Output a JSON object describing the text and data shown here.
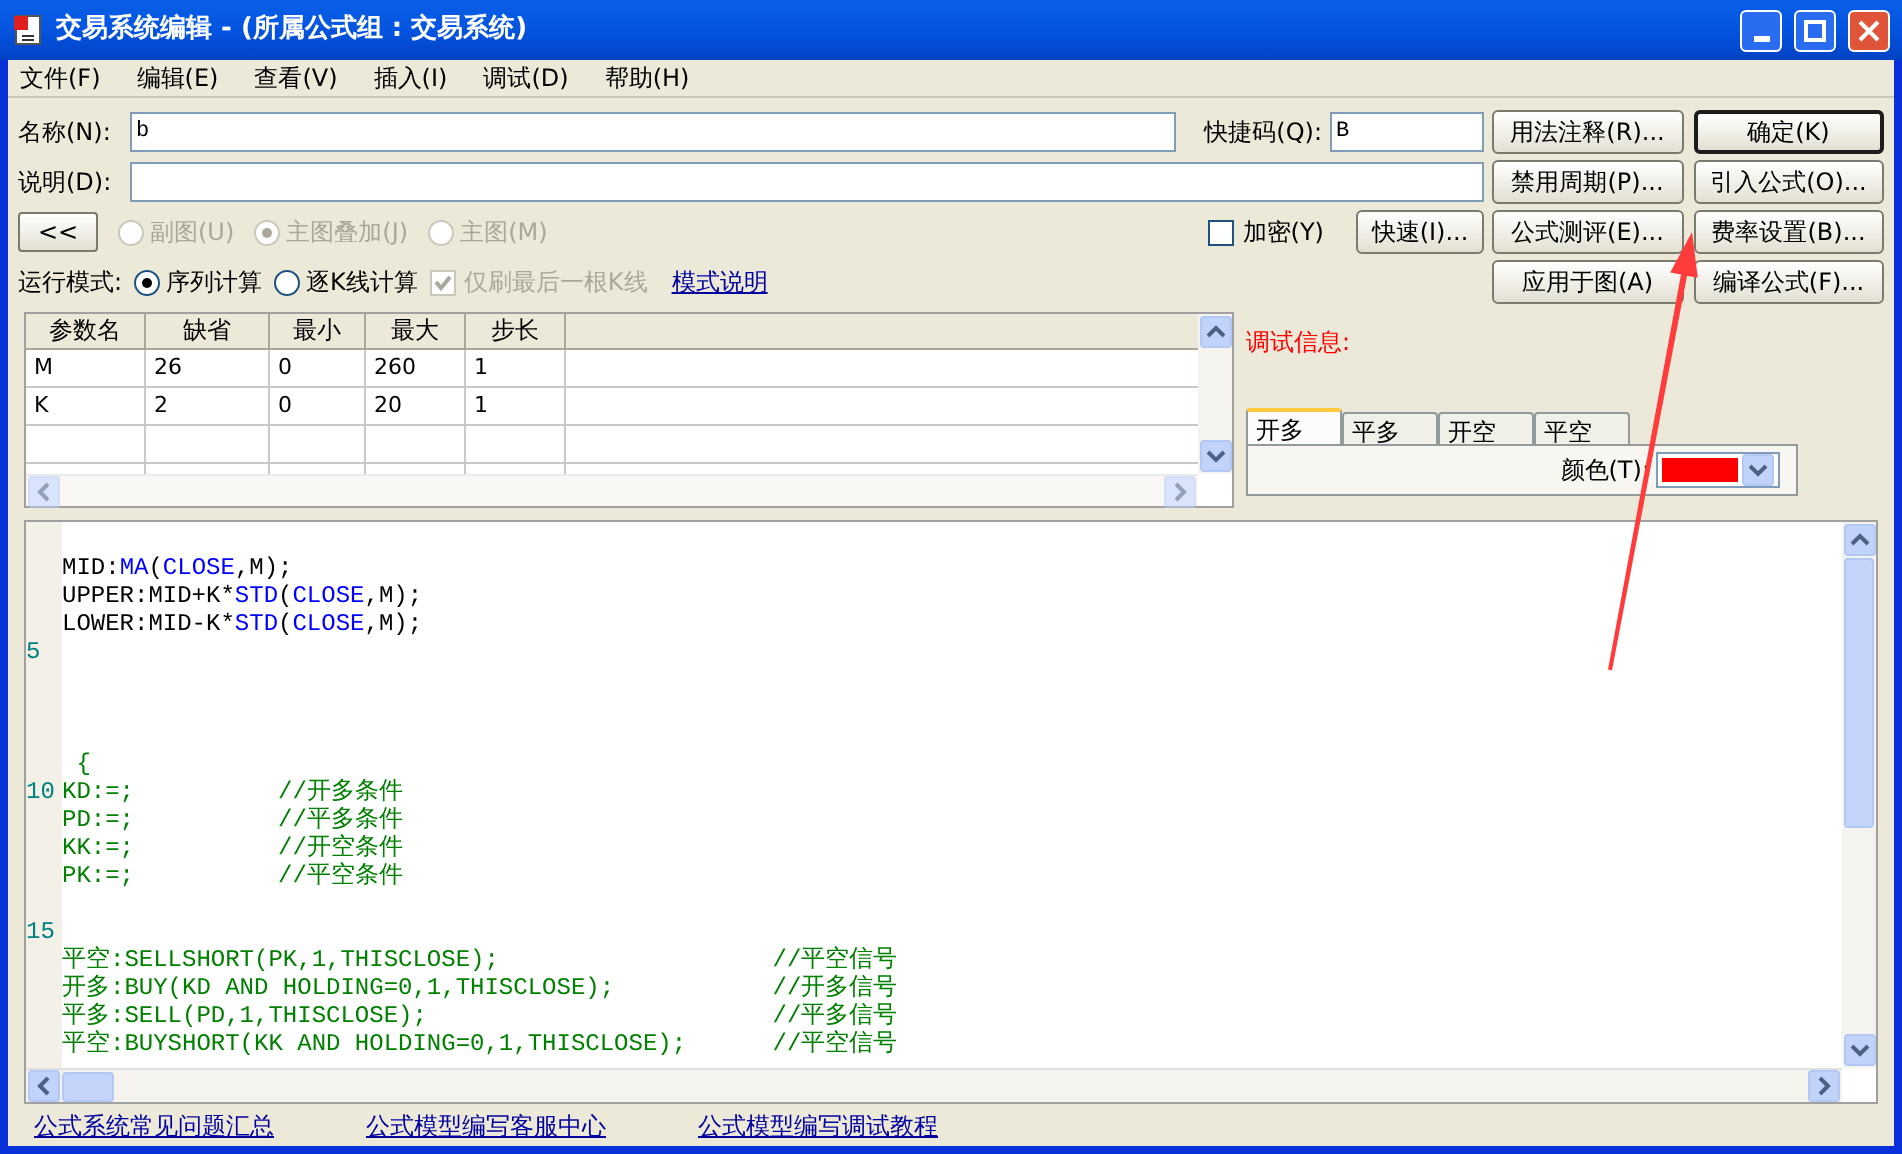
{
  "window": {
    "title": "交易系统编辑 - (所属公式组 : 交易系统)"
  },
  "menu": [
    "文件(F)",
    "编辑(E)",
    "查看(V)",
    "插入(I)",
    "调试(D)",
    "帮助(H)"
  ],
  "form": {
    "name_label": "名称(N):",
    "name_value": "b",
    "shortcut_label": "快捷码(Q):",
    "shortcut_value": "B",
    "desc_label": "说明(D):"
  },
  "collapse_button": "<<",
  "chart_modes": [
    {
      "label": "副图(U)",
      "selected": false,
      "disabled": true
    },
    {
      "label": "主图叠加(J)",
      "selected": true,
      "disabled": true
    },
    {
      "label": "主图(M)",
      "selected": false,
      "disabled": true
    }
  ],
  "encrypt": {
    "label": "加密(Y)",
    "checked": false
  },
  "quick_button": "快速(I)...",
  "run_mode": {
    "label": "运行模式:",
    "options": [
      {
        "label": "序列计算",
        "selected": true
      },
      {
        "label": "逐K线计算",
        "selected": false
      }
    ],
    "refresh_last": {
      "label": "仅刷最后一根K线",
      "checked": true,
      "disabled": true
    },
    "help_link": "模式说明"
  },
  "buttons": [
    {
      "label": "用法注释(R)...",
      "default": false
    },
    {
      "label": "确定(K)",
      "default": true
    },
    {
      "label": "禁用周期(P)...",
      "default": false
    },
    {
      "label": "引入公式(O)...",
      "default": false
    },
    {
      "label": "公式测评(E)...",
      "default": false
    },
    {
      "label": "费率设置(B)...",
      "default": false
    },
    {
      "label": "应用于图(A)",
      "default": false
    },
    {
      "label": "编译公式(F)...",
      "default": false
    }
  ],
  "params_table": {
    "columns": [
      "参数名",
      "缺省",
      "最小",
      "最大",
      "步长"
    ],
    "rows": [
      [
        "M",
        "26",
        "0",
        "260",
        "1"
      ],
      [
        "K",
        "2",
        "0",
        "20",
        "1"
      ]
    ]
  },
  "debug": {
    "label": "调试信息:"
  },
  "signal_tabs": [
    {
      "label": "开多",
      "selected": true
    },
    {
      "label": "平多",
      "selected": false
    },
    {
      "label": "开空",
      "selected": false
    },
    {
      "label": "平空",
      "selected": false
    }
  ],
  "line_color": {
    "label": "颜色(T):",
    "color": "#ff0000"
  },
  "editor": {
    "lines": [
      {
        "kind": "blank"
      },
      {
        "kind": "code",
        "segments": [
          {
            "kind": "plain",
            "text": "MID:"
          },
          {
            "kind": "func",
            "text": "MA"
          },
          {
            "kind": "plain",
            "text": "("
          },
          {
            "kind": "func",
            "text": "CLOSE"
          },
          {
            "kind": "plain",
            "text": ",M);"
          }
        ]
      },
      {
        "kind": "code",
        "segments": [
          {
            "kind": "plain",
            "text": "UPPER:MID+K*"
          },
          {
            "kind": "func",
            "text": "STD"
          },
          {
            "kind": "plain",
            "text": "("
          },
          {
            "kind": "func",
            "text": "CLOSE"
          },
          {
            "kind": "plain",
            "text": ",M);"
          }
        ]
      },
      {
        "kind": "code",
        "segments": [
          {
            "kind": "plain",
            "text": "LOWER:MID-K*"
          },
          {
            "kind": "func",
            "text": "STD"
          },
          {
            "kind": "plain",
            "text": "("
          },
          {
            "kind": "func",
            "text": "CLOSE"
          },
          {
            "kind": "plain",
            "text": ",M);"
          }
        ]
      },
      {
        "kind": "blank",
        "number": "5"
      },
      {
        "kind": "blank"
      },
      {
        "kind": "blank"
      },
      {
        "kind": "blank"
      },
      {
        "kind": "code",
        "segments": [
          {
            "kind": "trade",
            "text": " {"
          }
        ]
      },
      {
        "kind": "code",
        "number": "10",
        "segments": [
          {
            "kind": "trade",
            "text": "KD:=;          //开多条件"
          }
        ]
      },
      {
        "kind": "code",
        "segments": [
          {
            "kind": "trade",
            "text": "PD:=;          //平多条件"
          }
        ]
      },
      {
        "kind": "code",
        "segments": [
          {
            "kind": "trade",
            "text": "KK:=;          //开空条件"
          }
        ]
      },
      {
        "kind": "code",
        "segments": [
          {
            "kind": "trade",
            "text": "PK:=;          //平空条件"
          }
        ]
      },
      {
        "kind": "blank"
      },
      {
        "kind": "blank",
        "number": "15"
      },
      {
        "kind": "code",
        "segments": [
          {
            "kind": "trade",
            "text": "平空:SELLSHORT(PK,1,THISCLOSE);                   //平空信号"
          }
        ]
      },
      {
        "kind": "code",
        "segments": [
          {
            "kind": "trade",
            "text": "开多:BUY(KD AND HOLDING=0,1,THISCLOSE);           //开多信号"
          }
        ]
      },
      {
        "kind": "code",
        "segments": [
          {
            "kind": "trade",
            "text": "平多:SELL(PD,1,THISCLOSE);                        //平多信号"
          }
        ]
      },
      {
        "kind": "code",
        "segments": [
          {
            "kind": "trade",
            "text": "平空:BUYSHORT(KK AND HOLDING=0,1,THISCLOSE);      //平空信号"
          }
        ]
      }
    ]
  },
  "footer_links": [
    "公式系统常见问题汇总",
    "公式模型编写客服中心",
    "公式模型编写调试教程"
  ]
}
